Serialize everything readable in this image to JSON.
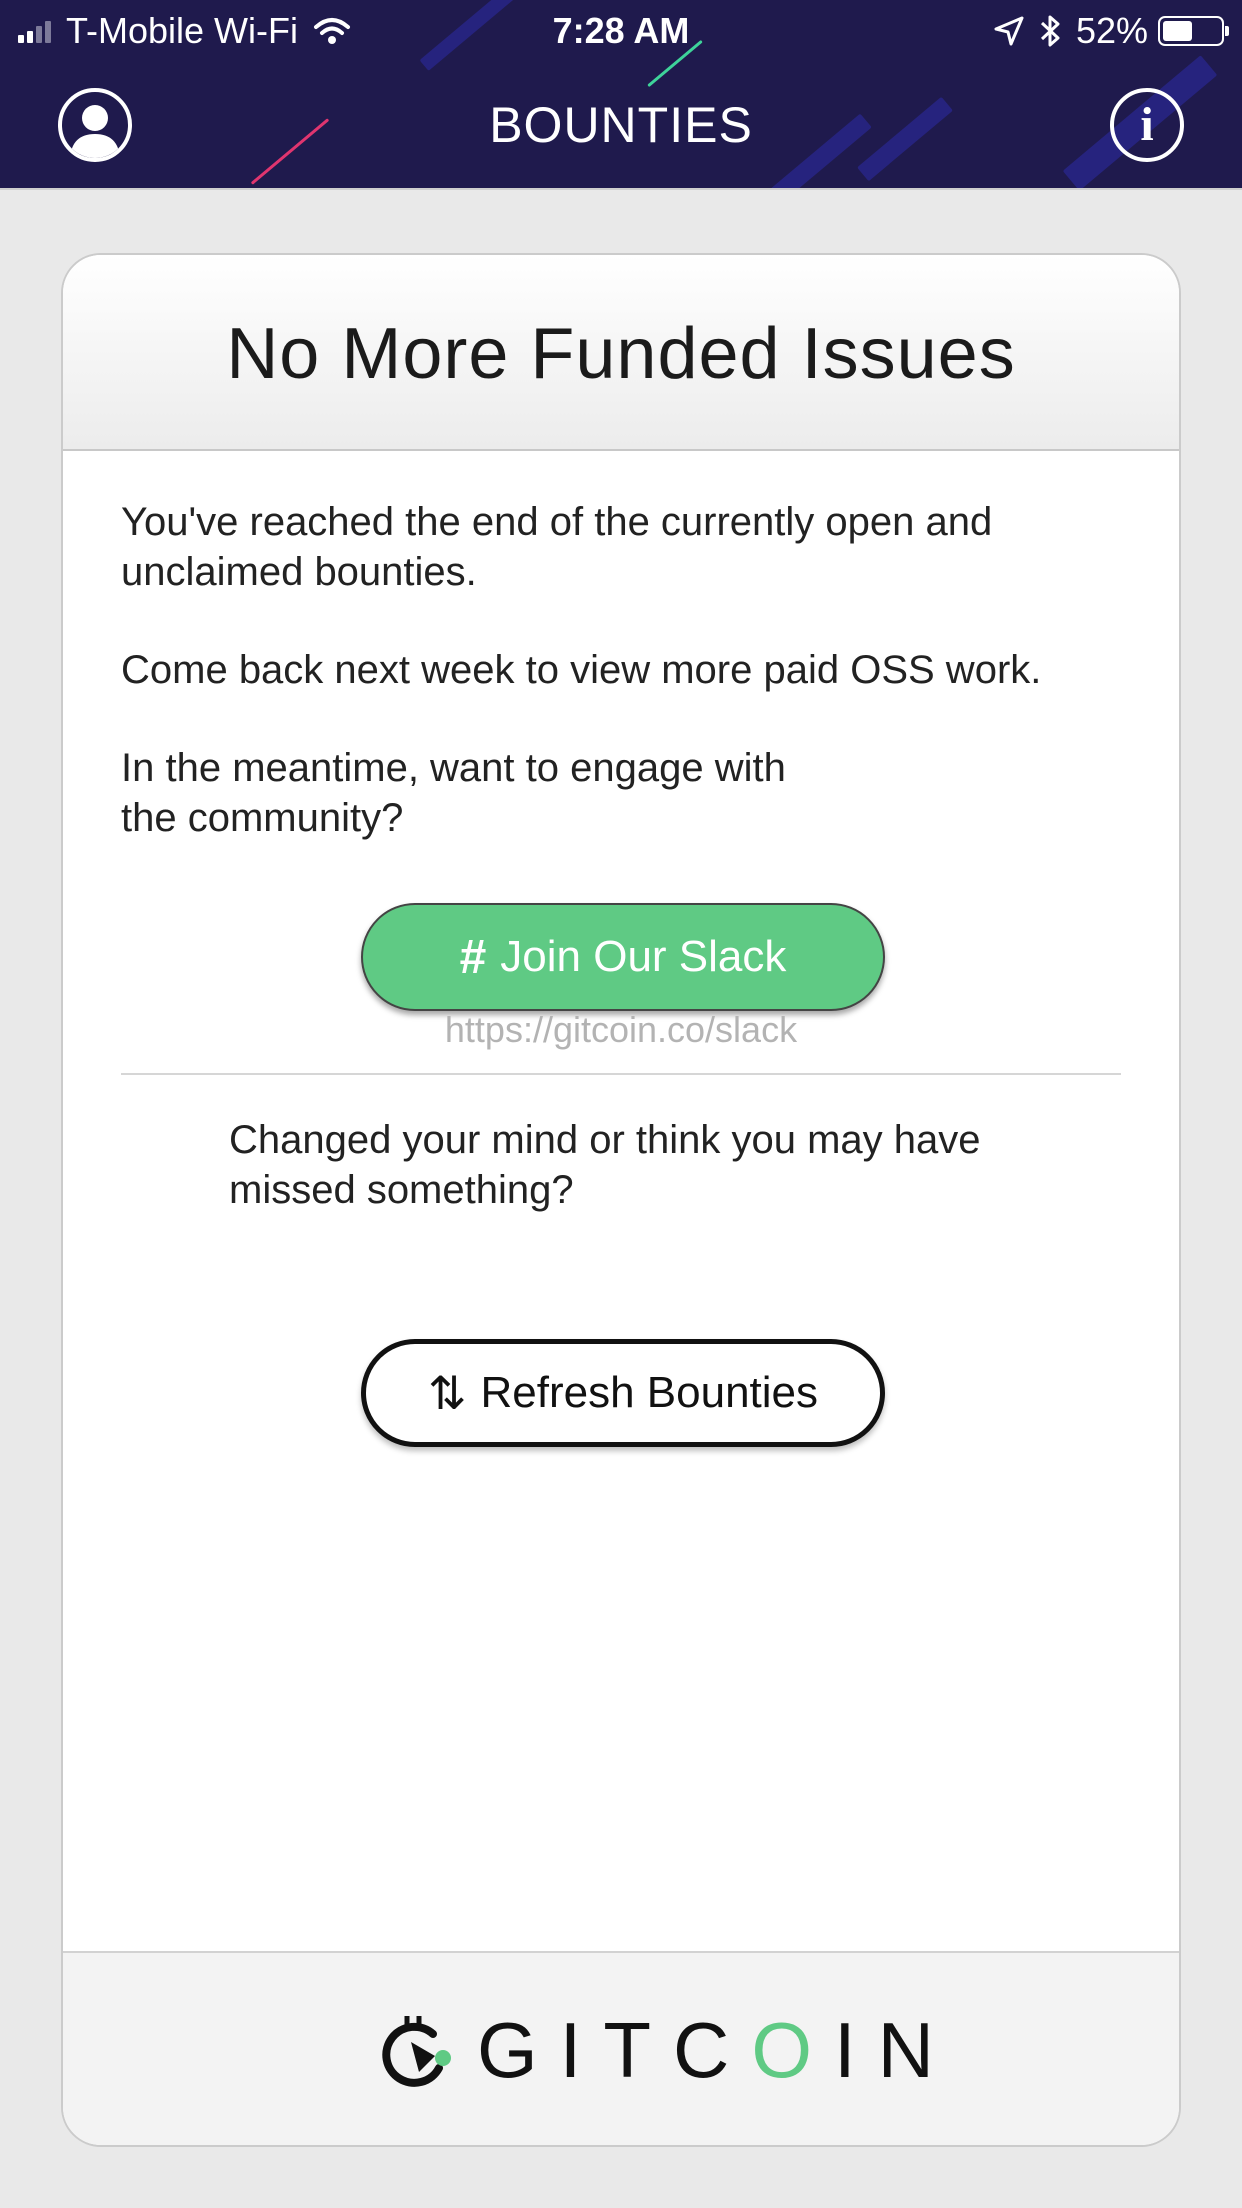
{
  "status_bar": {
    "carrier": "T-Mobile Wi-Fi",
    "time": "7:28 AM",
    "battery": "52%",
    "battery_level": 0.52
  },
  "header": {
    "title": "BOUNTIES",
    "info_glyph": "i",
    "left_icon": "profile-icon",
    "right_icon": "info-icon",
    "background_color": "#1f1a4d"
  },
  "card": {
    "title": "No More Funded Issues",
    "paragraph_1": "You've reached the end of the currently open and unclaimed bounties.",
    "paragraph_2": "Come back next week to view more paid OSS work.",
    "paragraph_3": "In the meantime, want to engage with the community?",
    "slack_button": {
      "icon": "hash-icon",
      "glyph": "#",
      "label": "Join Our Slack",
      "color": "#5fca84"
    },
    "slack_url": "https://gitcoin.co/slack",
    "paragraph_4": "Changed your mind or think you may have missed something?",
    "refresh_button": {
      "icon": "refresh-icon",
      "glyph": "⇅",
      "label": "Refresh Bounties"
    }
  },
  "footer": {
    "logo_part_1": "GITC",
    "logo_o": "O",
    "logo_part_2": "IN",
    "accent_color": "#5fca84"
  }
}
